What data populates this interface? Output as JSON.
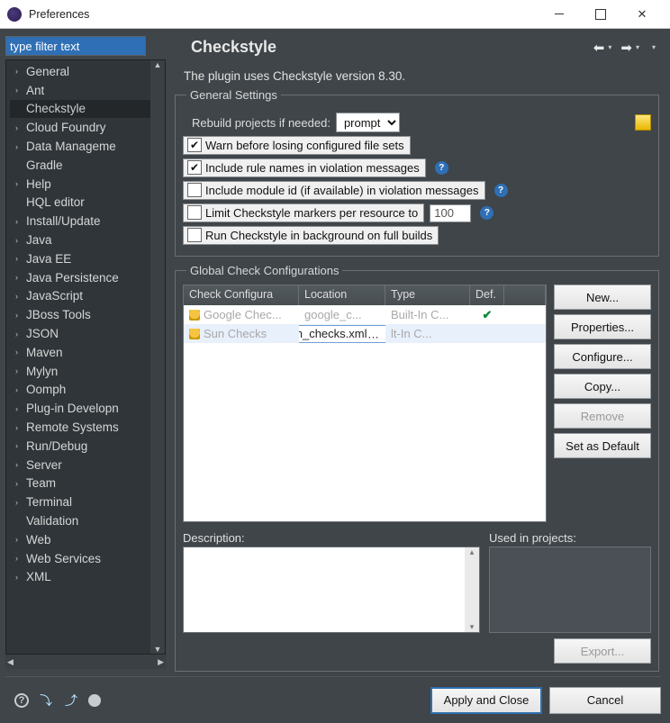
{
  "window": {
    "title": "Preferences"
  },
  "filter": {
    "placeholder": "type filter text"
  },
  "tree": {
    "items": [
      {
        "label": "General",
        "expandable": true
      },
      {
        "label": "Ant",
        "expandable": true
      },
      {
        "label": "Checkstyle",
        "expandable": false,
        "selected": true
      },
      {
        "label": "Cloud Foundry",
        "expandable": true
      },
      {
        "label": "Data Manageme",
        "expandable": true
      },
      {
        "label": "Gradle",
        "expandable": false
      },
      {
        "label": "Help",
        "expandable": true
      },
      {
        "label": "HQL editor",
        "expandable": false
      },
      {
        "label": "Install/Update",
        "expandable": true
      },
      {
        "label": "Java",
        "expandable": true
      },
      {
        "label": "Java EE",
        "expandable": true
      },
      {
        "label": "Java Persistence",
        "expandable": true
      },
      {
        "label": "JavaScript",
        "expandable": true
      },
      {
        "label": "JBoss Tools",
        "expandable": true
      },
      {
        "label": "JSON",
        "expandable": true
      },
      {
        "label": "Maven",
        "expandable": true
      },
      {
        "label": "Mylyn",
        "expandable": true
      },
      {
        "label": "Oomph",
        "expandable": true
      },
      {
        "label": "Plug-in Developn",
        "expandable": true
      },
      {
        "label": "Remote Systems",
        "expandable": true
      },
      {
        "label": "Run/Debug",
        "expandable": true
      },
      {
        "label": "Server",
        "expandable": true
      },
      {
        "label": "Team",
        "expandable": true
      },
      {
        "label": "Terminal",
        "expandable": true
      },
      {
        "label": "Validation",
        "expandable": false
      },
      {
        "label": "Web",
        "expandable": true
      },
      {
        "label": "Web Services",
        "expandable": true
      },
      {
        "label": "XML",
        "expandable": true
      }
    ]
  },
  "page": {
    "title": "Checkstyle",
    "intro": "The plugin uses Checkstyle version 8.30."
  },
  "general": {
    "legend": "General Settings",
    "rebuild_label": "Rebuild projects if needed:",
    "rebuild_value": "prompt",
    "warn_label": "Warn before losing configured file sets",
    "include_names_label": "Include rule names in violation messages",
    "include_module_label": "Include module id (if available) in violation messages",
    "limit_label": "Limit Checkstyle markers per resource to",
    "limit_value": "100",
    "background_label": "Run Checkstyle in background on full builds"
  },
  "globals": {
    "legend": "Global Check Configurations",
    "headers": {
      "c1": "Check Configura",
      "c2": "Location",
      "c3": "Type",
      "c4": "Def."
    },
    "rows": [
      {
        "name": "Google Chec...",
        "location": "google_c...",
        "type": "Built-In C...",
        "def": "✔"
      },
      {
        "name": "Sun Checks",
        "location": "sun_checks.xml",
        "type": "lt-In C...",
        "def": ""
      }
    ],
    "edit_value": "sun_checks.xml",
    "buttons": {
      "new": "New...",
      "properties": "Properties...",
      "configure": "Configure...",
      "copy": "Copy...",
      "remove": "Remove",
      "setdefault": "Set as Default",
      "export": "Export..."
    },
    "description_label": "Description:",
    "usedin_label": "Used in projects:"
  },
  "footer": {
    "apply": "Apply and Close",
    "cancel": "Cancel"
  }
}
